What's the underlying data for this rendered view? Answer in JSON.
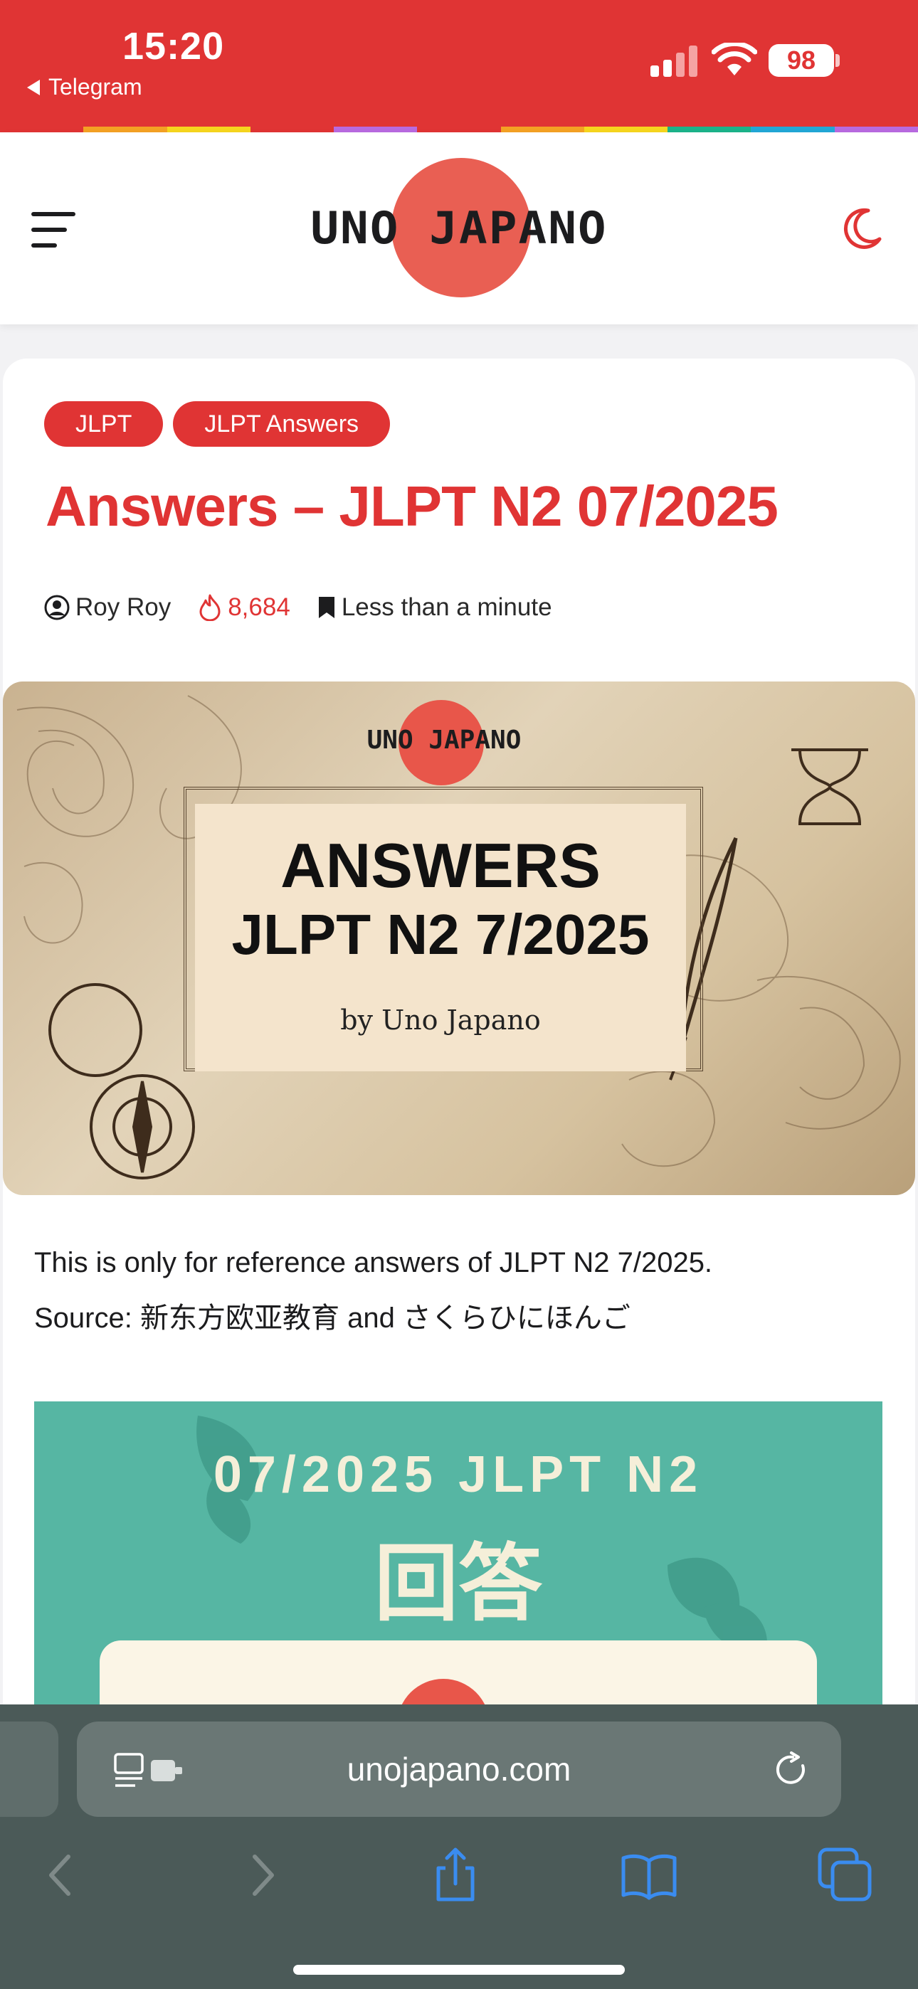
{
  "status_bar": {
    "time": "15:20",
    "back_app": "Telegram",
    "battery": "98",
    "icons": [
      "signal-icon",
      "wifi-icon",
      "battery-icon"
    ]
  },
  "colors": {
    "brand_red": "#e03434",
    "logo_sun": "#e8564a",
    "teal": "#56b6a3",
    "rainbow": [
      "#e03434",
      "#f4a124",
      "#f6d51e",
      "#e03434",
      "#b86ae0",
      "#e03434",
      "#f4a124",
      "#f6d51e",
      "#1cb38a",
      "#22a7d6",
      "#b86ae0"
    ]
  },
  "header": {
    "logo_text": "UNO JAPANO",
    "icons": [
      "menu-icon",
      "moon-icon"
    ]
  },
  "article": {
    "tags": [
      "JLPT",
      "JLPT Answers"
    ],
    "title": "Answers – JLPT N2 07/2025",
    "meta": {
      "author": "Roy Roy",
      "views": "8,684",
      "read_time": "Less than a minute"
    },
    "hero": {
      "logo_text": "UNO JAPANO",
      "heading_1": "ANSWERS",
      "heading_2": "JLPT N2 7/2025",
      "byline": "by Uno Japano"
    },
    "paragraph_1": "This is only for reference answers of JLPT N2 7/2025.",
    "paragraph_2": "Source: 新东方欧亚教育 and さくらひにほんご",
    "answer_image": {
      "heading_1": "07/2025 JLPT N2",
      "heading_2": "回答"
    }
  },
  "browser": {
    "url": "unojapano.com",
    "icons": [
      "page-menu-icon",
      "reload-icon",
      "back-icon",
      "forward-icon",
      "share-icon",
      "bookmarks-icon",
      "tabs-icon"
    ]
  }
}
